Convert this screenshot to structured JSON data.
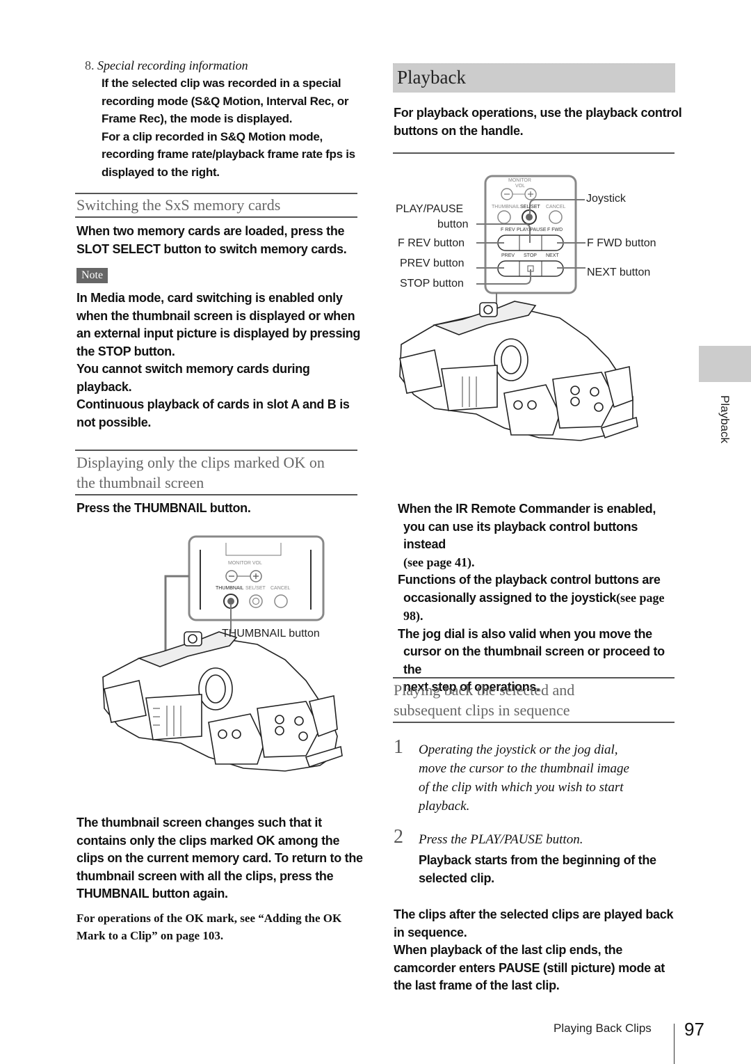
{
  "left": {
    "item8": {
      "number": "8.",
      "title": "Special recording information",
      "lines": [
        "If the selected clip was recorded in a special",
        "recording mode (S&Q Motion, Interval Rec, or",
        "Frame Rec), the mode is displayed.",
        "For a clip recorded in S&Q Motion mode,",
        "recording frame rate/playback frame rate fps is",
        "displayed to the right."
      ]
    },
    "switching": {
      "heading": "Switching the SxS memory cards",
      "lines": [
        "When two memory cards are loaded, press the",
        "SLOT SELECT button to switch memory cards."
      ],
      "note_label": "Note",
      "note_lines": [
        "In Media mode, card switching is enabled only",
        "when the thumbnail screen is displayed or when",
        "an external input picture is displayed by pressing",
        "the STOP button.",
        "You cannot switch memory cards during",
        "playback.",
        "Continuous playback of cards in slot A and B is",
        "not possible."
      ]
    },
    "displaying": {
      "heading_line1": "Displaying only the clips marked OK on",
      "heading_line2": "the thumbnail screen",
      "instruction": "Press the THUMBNAIL button.",
      "diagram": {
        "monitor_vol": "MONITOR VOL",
        "thumbnail": "THUMBNAIL",
        "sel_set": "SEL/SET",
        "cancel": "CANCEL",
        "callout": "THUMBNAIL button"
      },
      "result_lines": [
        "The thumbnail screen changes such that it",
        "contains only the clips marked OK among the",
        "clips on the current memory card. To return to the",
        "thumbnail screen with all the clips, press the",
        "THUMBNAIL button again."
      ],
      "ref_lines": [
        "For operations of the OK mark, see “Adding the OK",
        "Mark to a Clip” on page 103."
      ]
    }
  },
  "right": {
    "section_title": "Playback",
    "intro_lines": [
      "For playback operations, use the playback control",
      "buttons on the handle."
    ],
    "diagram": {
      "monitor": "MONITOR",
      "vol": "VOL",
      "thumbnail": "THUMBNAIL",
      "sel_set": "SEL/SET",
      "cancel": "CANCEL",
      "f_rev": "F REV",
      "play_pause": "PLAY/PAUSE",
      "f_fwd": "F FWD",
      "prev": "PREV",
      "stop": "STOP",
      "next": "NEXT",
      "callouts": {
        "joystick": "Joystick",
        "play_pause_1": "PLAY/PAUSE",
        "play_pause_2": "button",
        "f_rev": "F REV button",
        "prev": "PREV button",
        "stop": "STOP button",
        "f_fwd": "F FWD button",
        "next": "NEXT button"
      }
    },
    "notes": [
      {
        "bold": "When the IR Remote Commander is enabled,",
        "bold2": "you can use its playback control buttons instead",
        "serif": "(see page 41)."
      },
      {
        "bold": "Functions of the playback control buttons are",
        "bold2": "occasionally assigned to the joystick",
        "serif_inline": "(see page",
        "serif": "98)."
      },
      {
        "bold": "The jog dial is also valid when you move the",
        "bold2": "cursor on the thumbnail screen or proceed to the",
        "bold3": "next step of operations."
      }
    ],
    "sequence": {
      "heading_line1": "Playing back the selected and",
      "heading_line2": "subsequent clips in sequence",
      "steps": [
        {
          "num": "1",
          "lines": [
            "Operating the joystick or the jog dial,",
            "move the cursor to the thumbnail image",
            "of the clip with which you wish to start",
            "playback."
          ]
        },
        {
          "num": "2",
          "lines": [
            "Press the PLAY/PAUSE button."
          ],
          "result": [
            "Playback starts from the beginning of the",
            "selected clip."
          ]
        }
      ],
      "after_lines": [
        "The clips after the selected clips are played back",
        "in sequence.",
        "When playback of the last clip ends, the",
        "camcorder enters PAUSE (still picture) mode at",
        "the last frame of the last clip."
      ]
    }
  },
  "side_tab": {
    "label": "Playback"
  },
  "footer": {
    "section": "Playing Back Clips",
    "page": "97"
  }
}
